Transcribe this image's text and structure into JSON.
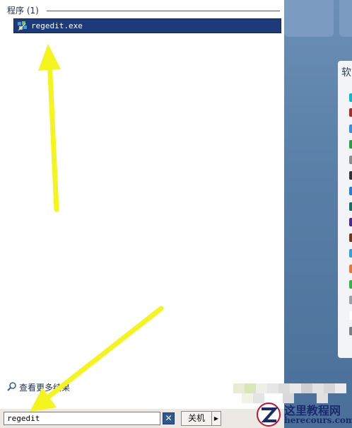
{
  "results": {
    "section_title": "程序 (1)",
    "items": [
      {
        "label": "regedit.exe",
        "icon": "regedit-icon"
      }
    ]
  },
  "see_more": {
    "label": "查看更多结果"
  },
  "search": {
    "value": "regedit",
    "clear_label": "✕"
  },
  "shutdown": {
    "label": "关机",
    "menu_label": "▶"
  },
  "side_panel": {
    "title": "软"
  },
  "watermark": {
    "brand": "这里教程网",
    "url": "herecours.com"
  },
  "colors": {
    "highlight": "#1d3b7a",
    "desktop": "#4a6f98",
    "arrow": "#f4f51e"
  }
}
